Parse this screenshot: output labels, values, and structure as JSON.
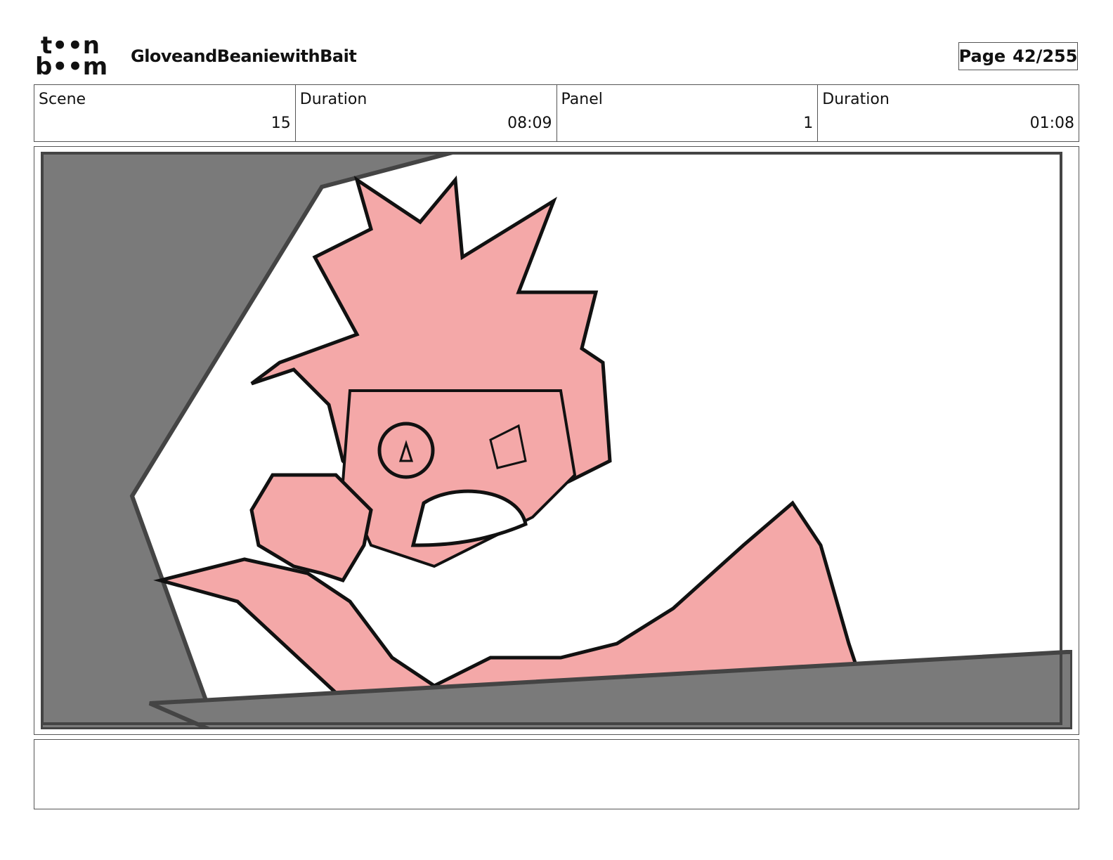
{
  "header": {
    "logo": {
      "line1": "t••n",
      "line2": "b••m",
      "text": "toon boom"
    },
    "project_title": "GloveandBeaniewithBait",
    "page": {
      "label": "Page",
      "value": "42/255"
    }
  },
  "info": [
    {
      "label": "Scene",
      "value": "15"
    },
    {
      "label": "Duration",
      "value": "08:09"
    },
    {
      "label": "Panel",
      "value": "1"
    },
    {
      "label": "Duration",
      "value": "01:08"
    }
  ],
  "panel": {
    "colors": {
      "skin": "#f4a8a8",
      "wall": "#7a7a7a",
      "line": "#111111",
      "background": "#ffffff"
    }
  },
  "notes": {
    "text": ""
  }
}
